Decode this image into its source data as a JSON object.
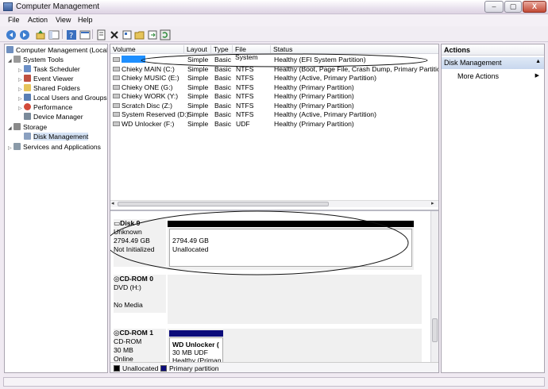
{
  "window": {
    "title": "Computer Management",
    "min": "–",
    "max": "▢",
    "close": "X"
  },
  "menu": [
    "File",
    "Action",
    "View",
    "Help"
  ],
  "tree": {
    "root": "Computer Management (Local",
    "system_tools": "System Tools",
    "items": [
      "Task Scheduler",
      "Event Viewer",
      "Shared Folders",
      "Local Users and Groups",
      "Performance",
      "Device Manager"
    ],
    "storage": "Storage",
    "disk_management": "Disk Management",
    "services": "Services and Applications"
  },
  "volumes": {
    "headers": [
      "Volume",
      "Layout",
      "Type",
      "File System",
      "Status"
    ],
    "rows": [
      {
        "volume": "",
        "layout": "Simple",
        "type": "Basic",
        "fs": "",
        "status": "Healthy (EFI System Partition)"
      },
      {
        "volume": "Chieky MAIN (C:)",
        "layout": "Simple",
        "type": "Basic",
        "fs": "NTFS",
        "status": "Healthy (Boot, Page File, Crash Dump, Primary Partition)"
      },
      {
        "volume": "Chieky MUSIC (E:)",
        "layout": "Simple",
        "type": "Basic",
        "fs": "NTFS",
        "status": "Healthy (Active, Primary Partition)"
      },
      {
        "volume": "Chieky ONE (G:)",
        "layout": "Simple",
        "type": "Basic",
        "fs": "NTFS",
        "status": "Healthy (Primary Partition)"
      },
      {
        "volume": "Chieky WORK (Y:)",
        "layout": "Simple",
        "type": "Basic",
        "fs": "NTFS",
        "status": "Healthy (Primary Partition)"
      },
      {
        "volume": "Scratch Disc (Z:)",
        "layout": "Simple",
        "type": "Basic",
        "fs": "NTFS",
        "status": "Healthy (Primary Partition)"
      },
      {
        "volume": "System Reserved (D:)",
        "layout": "Simple",
        "type": "Basic",
        "fs": "NTFS",
        "status": "Healthy (Active, Primary Partition)"
      },
      {
        "volume": "WD Unlocker (F:)",
        "layout": "Simple",
        "type": "Basic",
        "fs": "UDF",
        "status": "Healthy (Primary Partition)"
      }
    ]
  },
  "disks": [
    {
      "name": "Disk 9",
      "type": "Unknown",
      "size": "2794.49 GB",
      "state": "Not Initialized",
      "part_size": "2794.49 GB",
      "part_state": "Unallocated"
    },
    {
      "name": "CD-ROM 0",
      "type": "DVD (H:)",
      "size": "",
      "state": "No Media"
    },
    {
      "name": "CD-ROM 1",
      "type": "CD-ROM",
      "size": "30 MB",
      "state": "Online",
      "part_name": "WD Unlocker  (",
      "part_size": "30 MB UDF",
      "part_state": "Healthy (Priman"
    }
  ],
  "legend": {
    "unallocated": "Unallocated",
    "primary": "Primary partition"
  },
  "actions": {
    "title": "Actions",
    "section": "Disk Management",
    "more": "More Actions"
  },
  "colors": {
    "unallocated": "#000000",
    "primary": "#0b0b7a",
    "selection": "#c8d7ee",
    "annotation": "#111111"
  },
  "icons": [
    "back-icon",
    "forward-icon",
    "up-icon",
    "show-hide-tree-icon",
    "help-icon",
    "console-icon",
    "delete-icon",
    "properties-icon",
    "open-icon",
    "export-icon",
    "refresh-icon"
  ]
}
